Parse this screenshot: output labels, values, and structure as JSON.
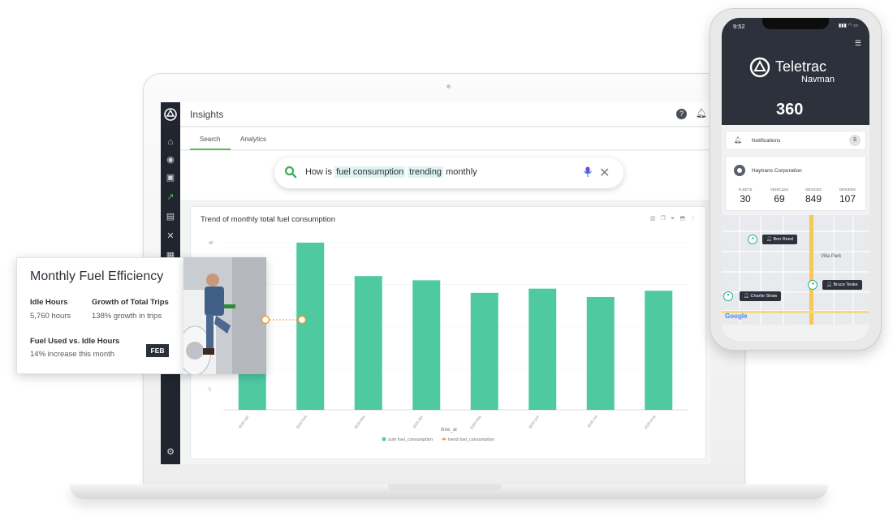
{
  "laptop": {
    "app": {
      "title": "Insights",
      "tabs": [
        {
          "label": "Search",
          "active": true
        },
        {
          "label": "Analytics",
          "active": false
        }
      ],
      "search": {
        "segments": [
          {
            "text": "How is ",
            "highlight": false
          },
          {
            "text": "fuel consumption",
            "highlight": true
          },
          {
            "text": " ",
            "highlight": false
          },
          {
            "text": "trending",
            "highlight": true
          },
          {
            "text": " monthly",
            "highlight": false
          }
        ]
      },
      "sidebar_icons": [
        "home-icon",
        "globe-icon",
        "chat-icon",
        "chart-icon",
        "document-icon",
        "tools-icon",
        "table-icon",
        "settings-icon"
      ]
    }
  },
  "chart_data": {
    "type": "bar",
    "title": "Trend of monthly total fuel consumption",
    "xlabel": "time_at",
    "ylabel": "",
    "categories": [
      "2020-Jan",
      "2020-Feb",
      "2020-Mar",
      "2020-Apr",
      "2020-May",
      "2020-Jun",
      "2020-Jul",
      "2020-Aug"
    ],
    "series": [
      {
        "name": "sum fuel_consumption",
        "values": [
          25,
          40,
          32,
          31,
          28,
          29,
          27,
          28.5
        ],
        "color": "#4ec9a0"
      },
      {
        "name": "trend fuel_consumption",
        "values": [],
        "color": "#f39a2a"
      }
    ],
    "ylim": [
      0,
      40
    ],
    "yticks": [
      "40",
      "5"
    ],
    "grid": true,
    "legend": "bottom"
  },
  "efficiency_card": {
    "title": "Monthly Fuel Efficiency",
    "metrics": [
      {
        "label": "Idle Hours",
        "value": "5,760 hours"
      },
      {
        "label": "Growth of Total Trips",
        "value": "138% growth in trips"
      },
      {
        "label": "Fuel Used vs. Idle Hours",
        "value": "14% increase this month"
      }
    ],
    "badge": "FEB"
  },
  "phone": {
    "time": "9:52",
    "brand": "Teletrac",
    "brand_sub": "Navman",
    "product": "360",
    "notifications": {
      "label": "Notifications",
      "count": "5"
    },
    "company": "Haytrans Corporation",
    "stats": [
      {
        "label": "FLEETS",
        "value": "30"
      },
      {
        "label": "VEHICLES",
        "value": "69"
      },
      {
        "label": "DEVICES",
        "value": "849"
      },
      {
        "label": "DRIVERS",
        "value": "107"
      }
    ],
    "map": {
      "pins": [
        "Ben Reed",
        "Bruce Teske",
        "Charlie Shaw"
      ],
      "place": "Villa Park",
      "attribution": "Google"
    }
  },
  "colors": {
    "accent": "#4ec9a0",
    "sidebar": "#21252f",
    "phone_header": "#2c313c",
    "tab_active": "#5cb85c"
  }
}
